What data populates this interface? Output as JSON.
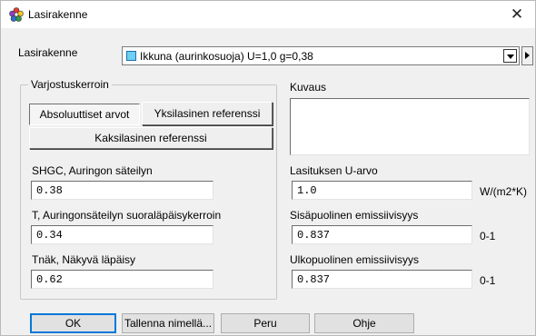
{
  "window": {
    "title": "Lasirakenne",
    "close_symbol": "✕",
    "icon": "app-palette-icon"
  },
  "glazing": {
    "label": "Lasirakenne",
    "selected_value": "Ikkuna (aurinkosuoja) U=1,0 g=0,38",
    "swatch_color": "#6fd0f2"
  },
  "shading": {
    "group_title": "Varjostuskerroin",
    "absolute_button": "Absoluuttiset arvot",
    "single_ref_button": "Yksilasinen referenssi",
    "double_ref_button": "Kaksilasinen referenssi"
  },
  "fields": {
    "shgc_label": "SHGC, Auringon säteilyn",
    "shgc_value": "0.38",
    "t_label": "T, Auringonsäteilyn suoraläpäisykerroin",
    "t_value": "0.34",
    "tvis_label": "Tnäk, Näkyvä läpäisy",
    "tvis_value": "0.62"
  },
  "description": {
    "label": "Kuvaus",
    "value": ""
  },
  "properties": {
    "u_label": "Lasituksen U-arvo",
    "u_value": "1.0",
    "u_unit": "W/(m2*K)",
    "inner_label": "Sisäpuolinen emissiivisyys",
    "inner_value": "0.837",
    "inner_unit": "0-1",
    "outer_label": "Ulkopuolinen emissiivisyys",
    "outer_value": "0.837",
    "outer_unit": "0-1"
  },
  "buttons": {
    "ok": "OK",
    "save_as": "Tallenna nimellä...",
    "cancel": "Peru",
    "help": "Ohje"
  }
}
